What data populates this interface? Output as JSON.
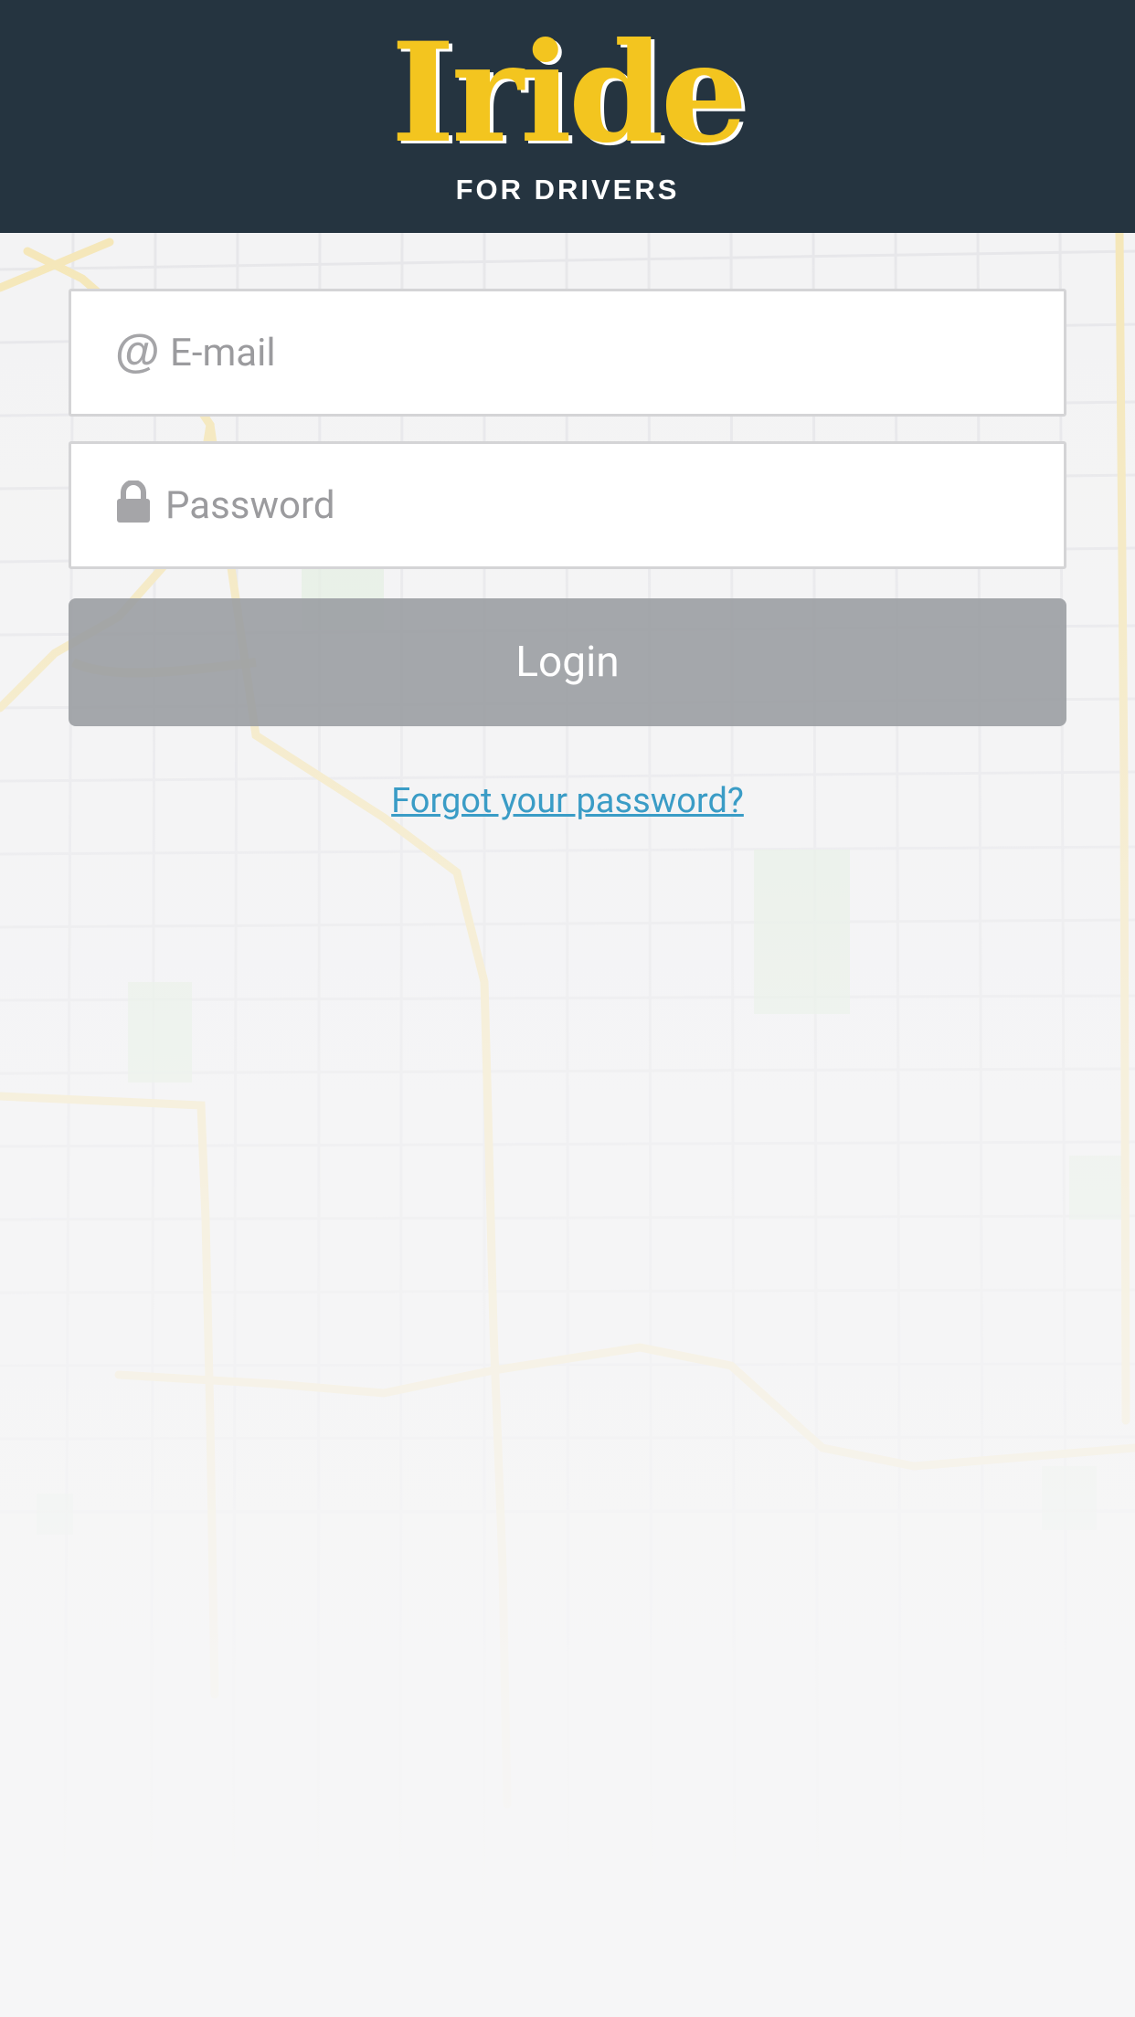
{
  "header": {
    "logo_text": "Iride",
    "logo_subtitle": "FOR DRIVERS",
    "background_color": "#253440",
    "logo_color": "#f3c51f"
  },
  "login_form": {
    "email": {
      "placeholder": "E-mail",
      "value": "",
      "icon": "at-sign-icon"
    },
    "password": {
      "placeholder": "Password",
      "value": "",
      "icon": "lock-icon"
    },
    "submit_label": "Login",
    "submit_state": "disabled",
    "forgot_password_label": "Forgot your password?",
    "link_color": "#3a9cc6"
  },
  "background": {
    "type": "city street map"
  }
}
